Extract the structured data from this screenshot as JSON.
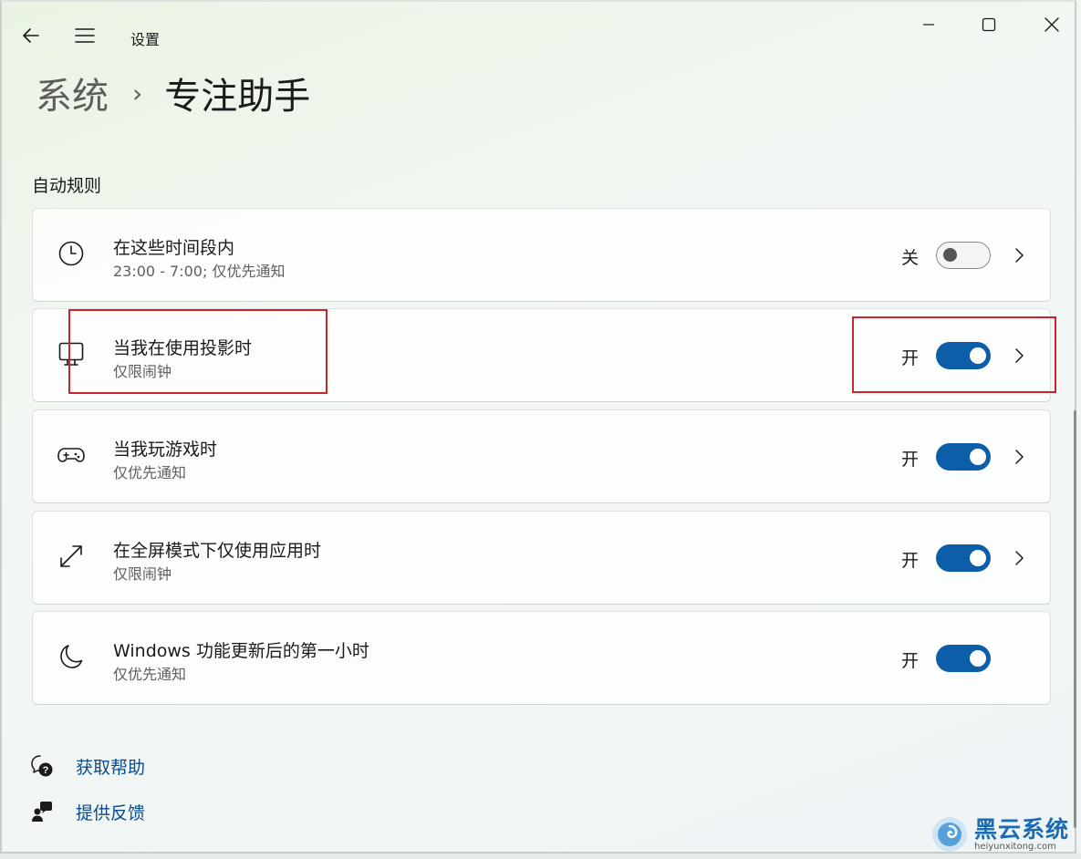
{
  "window": {
    "app_title": "设置",
    "controls": {
      "minimize": "minimize",
      "maximize": "maximize",
      "close": "close"
    }
  },
  "breadcrumb": {
    "parent": "系统",
    "separator": "›",
    "current": "专注助手"
  },
  "section": {
    "title": "自动规则"
  },
  "rules": [
    {
      "icon": "clock-icon",
      "title": "在这些时间段内",
      "subtitle": "23:00 - 7:00; 仅优先通知",
      "state_label": "关",
      "toggle_on": false,
      "has_chevron": true
    },
    {
      "icon": "monitor-icon",
      "title": "当我在使用投影时",
      "subtitle": "仅限闹钟",
      "state_label": "开",
      "toggle_on": true,
      "has_chevron": true
    },
    {
      "icon": "gamepad-icon",
      "title": "当我玩游戏时",
      "subtitle": "仅优先通知",
      "state_label": "开",
      "toggle_on": true,
      "has_chevron": true
    },
    {
      "icon": "fullscreen-icon",
      "title": "在全屏模式下仅使用应用时",
      "subtitle": "仅限闹钟",
      "state_label": "开",
      "toggle_on": true,
      "has_chevron": true
    },
    {
      "icon": "moon-icon",
      "title": "Windows 功能更新后的第一小时",
      "subtitle": "仅优先通知",
      "state_label": "开",
      "toggle_on": true,
      "has_chevron": false
    }
  ],
  "links": {
    "help": "获取帮助",
    "feedback": "提供反馈"
  },
  "watermark": {
    "brand": "黑云系统",
    "url": "heiyunxitong.com"
  },
  "colors": {
    "accent": "#0c5ea8",
    "link": "#0a4b8c",
    "highlight": "#c8262c"
  }
}
